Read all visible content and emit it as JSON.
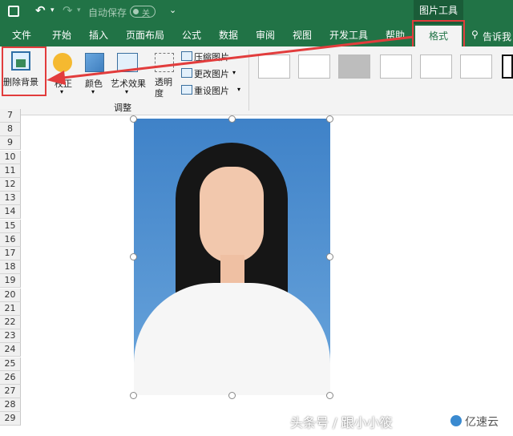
{
  "titlebar": {
    "autosave_label": "自动保存",
    "autosave_state": "关",
    "context_tab_group": "图片工具"
  },
  "tabs": [
    {
      "label": "文件"
    },
    {
      "label": "开始"
    },
    {
      "label": "插入"
    },
    {
      "label": "页面布局"
    },
    {
      "label": "公式"
    },
    {
      "label": "数据"
    },
    {
      "label": "审阅"
    },
    {
      "label": "视图"
    },
    {
      "label": "开发工具"
    },
    {
      "label": "帮助"
    },
    {
      "label": "格式"
    }
  ],
  "tell_me": "告诉我",
  "ribbon": {
    "remove_background": "删除背景",
    "corrections": "校正",
    "color": "颜色",
    "artistic_effects": "艺术效果",
    "transparency": "透明度",
    "compress": "压缩图片",
    "change": "更改图片",
    "reset": "重设图片",
    "group_adjust": "调整"
  },
  "rows": [
    "7",
    "8",
    "9",
    "10",
    "11",
    "12",
    "13",
    "14",
    "15",
    "16",
    "17",
    "18",
    "19",
    "20",
    "21",
    "22",
    "23",
    "24",
    "25",
    "26",
    "27",
    "28",
    "29"
  ],
  "watermark": {
    "text": "头条号 / 跟小小筱",
    "logo": "亿速云"
  },
  "colors": {
    "excel_green": "#217346",
    "highlight_red": "#e23c3c",
    "photo_bg": "#4f8fce"
  }
}
